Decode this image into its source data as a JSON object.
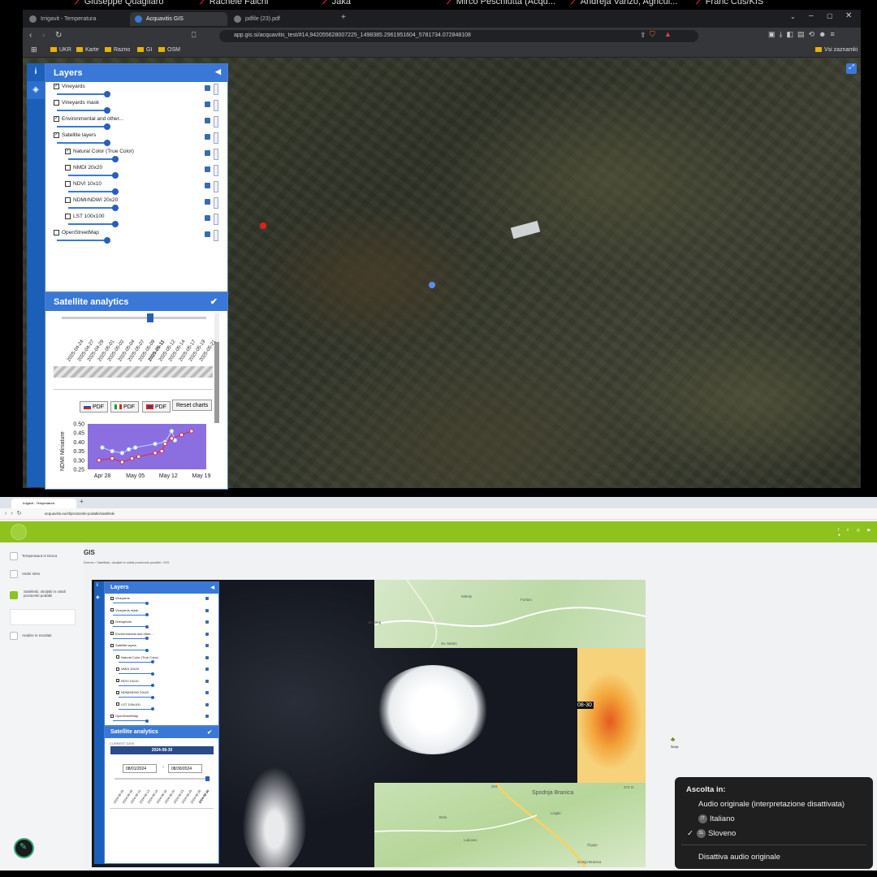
{
  "meeting_names": [
    "Giuseppe Quagliaro",
    "Rachele Falchi",
    "Jaka",
    "Mirco Peschiutta (Acqu...",
    "Andreja Vanzo, Agricul...",
    "Franc Čuš/KIS"
  ],
  "top": {
    "tabs": [
      "Irrigavit - Temperatura",
      "Acquavitis GIS",
      "pdfile (23).pdf",
      "+"
    ],
    "url": "app.gis.si/acquavitis_test/#14,942055628007225_1498385.2961951604_5781734.072848108",
    "bookmarks": [
      "UKR",
      "Karte",
      "Razno",
      "GI",
      "OSM"
    ],
    "bookmarks_right": "Vsi zaznamki",
    "layers": {
      "title": "Layers",
      "items": [
        "Vineyards",
        "Vineyards mask",
        "Environmental and other...",
        "Satellite layers",
        "Natural Color (True Color)",
        "NMDI 20x20",
        "NDVI 10x10",
        "NDMI/NDWI 20x20",
        "LST 100x100",
        "OpenStreetMap"
      ],
      "checked": [
        true,
        false,
        true,
        true,
        true,
        false,
        false,
        false,
        false,
        false
      ]
    },
    "analytics": {
      "title": "Satellite analytics",
      "dates": [
        "2025-04-24",
        "2025-04-27",
        "2025-04-29",
        "2025-05-01",
        "2025-05-02",
        "2025-05-04",
        "2025-05-07",
        "2025-05-09",
        "2025-05-11",
        "2025-05-12",
        "2025-05-14",
        "2025-05-17",
        "2025-05-19",
        "2025-05-21"
      ],
      "selected_date": "2025-05-11",
      "pdf_label": "PDF",
      "reset_label": "Reset charts"
    }
  },
  "chart_data": {
    "type": "line",
    "ylabel": "NDMI Miniature",
    "xlabel": "",
    "x": [
      "Apr 28",
      "May 05",
      "May 12",
      "May 19"
    ],
    "ylim": [
      0.25,
      0.5
    ],
    "yticks": [
      "0.50",
      "0.45",
      "0.40",
      "0.35",
      "0.30",
      "0.25"
    ],
    "series": [
      {
        "points": [
          [
            0,
            0.37
          ],
          [
            0.15,
            0.35
          ],
          [
            0.3,
            0.34
          ],
          [
            0.4,
            0.36
          ],
          [
            0.5,
            0.37
          ],
          [
            0.8,
            0.39
          ],
          [
            0.95,
            0.4
          ],
          [
            1.05,
            0.46
          ],
          [
            1.1,
            0.41
          ]
        ],
        "color": "#b9d8ff"
      },
      {
        "points": [
          [
            -0.05,
            0.3
          ],
          [
            0.15,
            0.31
          ],
          [
            0.3,
            0.29
          ],
          [
            0.45,
            0.31
          ],
          [
            0.55,
            0.32
          ],
          [
            0.8,
            0.34
          ],
          [
            0.9,
            0.35
          ],
          [
            0.95,
            0.39
          ],
          [
            1.05,
            0.42
          ],
          [
            1.2,
            0.44
          ],
          [
            1.35,
            0.46
          ]
        ],
        "color": "#e0224a"
      }
    ]
  },
  "bottom": {
    "tabs": [
      "Irrigavit - Temperatura",
      "+"
    ],
    "url": "acquavitis.eu/sl/prostorski-podatki/satelitski",
    "nav": [
      "Temperatura in tirnica",
      "Vodni stres",
      "Satelitski, okoljski in ostali prostorski podatki",
      "",
      "Analize in rezultati"
    ],
    "page_title": "GIS",
    "breadcrumb": "Domov  ›  Satelitski, okoljski in ostali prostorski podatki  ›  GIS",
    "layers": {
      "title": "Layers",
      "items": [
        "Vineyards",
        "Vineyards mask",
        "Orthophoto",
        "Environmental and other...",
        "Satellite layers",
        "Natural Color (True Color)",
        "NMDI 20x20",
        "NDVI 10x10",
        "NDMI/NDWI 20x20",
        "LST 100x100",
        "OpenStreetMap"
      ]
    },
    "analytics": {
      "title": "Satellite analytics",
      "current_date_label": "CURRENT DATE",
      "current_date": "2024-08-30",
      "from": "08/01/2024",
      "to": "08/30/2024",
      "dash": "-",
      "dates": [
        "2024-08-05",
        "2024-08-08",
        "2024-08-10",
        "2024-08-13",
        "2024-08-15",
        "2024-08-18",
        "2024-08-20",
        "2024-08-23",
        "2024-08-25",
        "2024-08-28",
        "2024-08-30"
      ]
    },
    "map_labels": [
      "Mihely",
      "Furlani",
      "cki Breg",
      "Sv. Martin",
      "08-30",
      "204",
      "Spodnja Branica",
      "Brdo",
      "Lisjaki",
      "Lukovec",
      "Čigoje",
      "Dolnja Branica",
      "272 m",
      "Škrilje"
    ],
    "audio_menu": {
      "title": "Ascolta in:",
      "original": "Audio originale (interpretazione disattivata)",
      "italian": "Italiano",
      "italian_badge": "IT",
      "slovenian": "Sloveno",
      "slovenian_badge": "SL",
      "disable": "Disattiva audio originale"
    }
  }
}
